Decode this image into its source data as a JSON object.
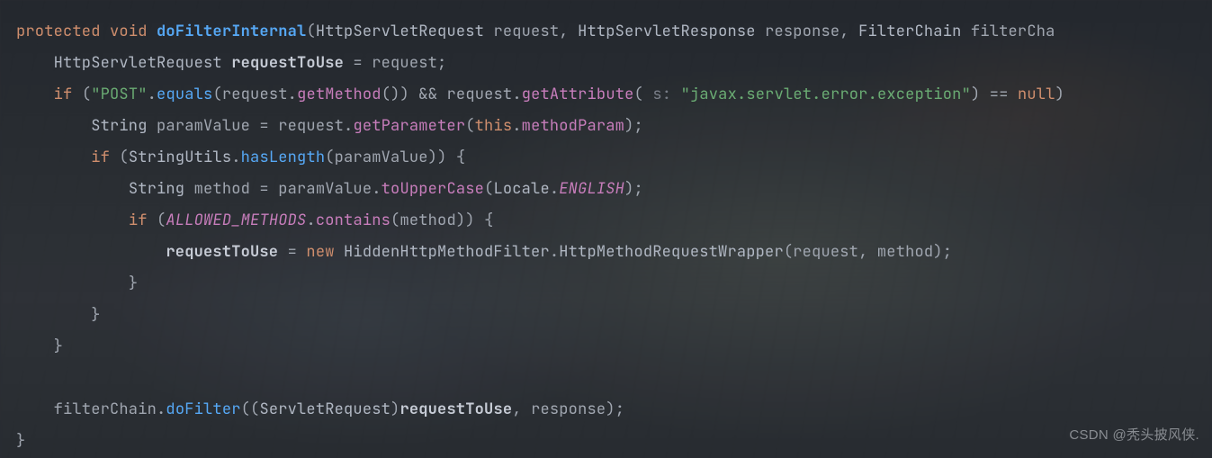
{
  "watermark": "CSDN @秃头披风侠.",
  "kw": {
    "protected": "protected",
    "void": "void",
    "if1": "if",
    "if2": "if",
    "if3": "if",
    "new": "new",
    "this": "this",
    "null": "null"
  },
  "decl": {
    "doFilterInternal": "doFilterInternal"
  },
  "ty": {
    "HttpServletRequest1": "HttpServletRequest",
    "HttpServletResponse": "HttpServletResponse",
    "FilterChain": "FilterChain",
    "HttpServletRequest2": "HttpServletRequest",
    "String1": "String",
    "StringUtils": "StringUtils",
    "String2": "String",
    "Locale": "Locale",
    "HiddenHttpMethodFilter": "HiddenHttpMethodFilter",
    "HttpMethodRequestWrapper": "HttpMethodRequestWrapper",
    "ServletRequest": "ServletRequest"
  },
  "id": {
    "request_p": "request",
    "response_p": "response",
    "filterChain_p": "filterCha",
    "requestToUse_d": "requestToUse",
    "request_r": "request",
    "paramValue_d": "paramValue",
    "paramValue_u": "paramValue",
    "method_d": "method",
    "method_u1": "method",
    "method_u2": "method",
    "requestToUse_a": "requestToUse",
    "request_a": "request",
    "filterChain_u": "filterChain",
    "requestToUse_u": "requestToUse",
    "response_u": "response",
    "paramValue_c": "paramValue",
    "request_c1": "request",
    "request_c2": "request",
    "request_c3": "request"
  },
  "fn": {
    "equals": "equals",
    "hasLength": "hasLength",
    "doFilter": "doFilter"
  },
  "mth": {
    "getMethod": "getMethod",
    "getAttribute": "getAttribute",
    "getParameter": "getParameter",
    "methodParam": "methodParam",
    "toUpperCase": "toUpperCase",
    "contains": "contains"
  },
  "cnst": {
    "ALLOWED_METHODS": "ALLOWED_METHODS",
    "ENGLISH": "ENGLISH"
  },
  "str": {
    "post": "\"POST\"",
    "err": "\"javax.servlet.error.exception\""
  },
  "hint": {
    "s": "s:"
  },
  "punct": {
    "lp1": "(",
    "rp1": ")",
    "c1": ",",
    "c2": ",",
    "eq1": " = ",
    "sc1": ";",
    "lp2": "(",
    "rp2": ")",
    "dot1": ".",
    "lp3": "(",
    "rp3": ")",
    "amp": " && ",
    "dot2": ".",
    "lp4": "(",
    "sp1": " ",
    "rp4": ")",
    "eqeq": " == ",
    "rp5": ")",
    "sp2": " ",
    "lb1": "{",
    "eq2": " = ",
    "dot3": ".",
    "lp5": "(",
    "dot4": ".",
    "rp6": ")",
    "sc2": ";",
    "lp6": "(",
    "dot5": ".",
    "lp7": "(",
    "rp7": ")",
    "rp8": ")",
    "sp3": " ",
    "lb2": "{",
    "eq3": " = ",
    "dot6": ".",
    "lp8": "(",
    "dot7": ".",
    "rp9": ")",
    "sc3": ";",
    "lp9": "(",
    "dot8": ".",
    "lp10": "(",
    "rp10": ")",
    "rp11": ")",
    "sp4": " ",
    "lb3": "{",
    "eq4": " = ",
    "sp5": " ",
    "dot9": ".",
    "lp11": "(",
    "c3": ",",
    "sp6": " ",
    "rp12": ")",
    "sc4": ";",
    "rb1": "}",
    "rb2": "}",
    "rb3": "}",
    "dot10": ".",
    "lp12": "(",
    "lp13": "(",
    "rp13": ")",
    "c4": ",",
    "sp7": " ",
    "rp14": ")",
    "sc5": ";",
    "rb4": "}"
  }
}
